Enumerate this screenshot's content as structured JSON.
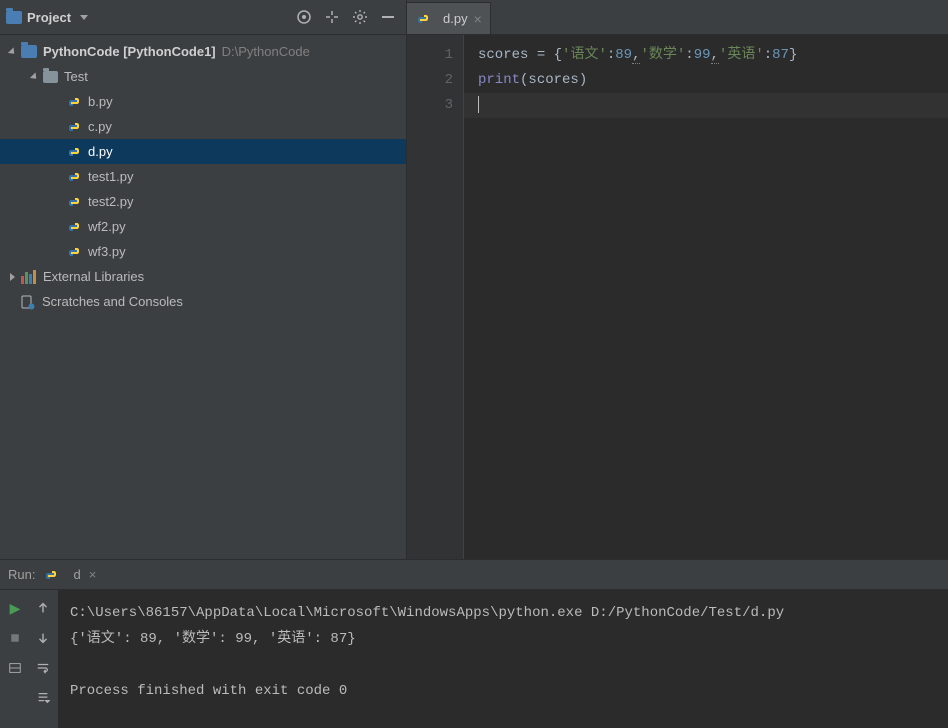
{
  "projectPanel": {
    "title": "Project",
    "rootName": "PythonCode",
    "rootExtra": "[PythonCode1]",
    "rootPath": "D:\\PythonCode",
    "testFolder": "Test",
    "files": [
      "b.py",
      "c.py",
      "d.py",
      "test1.py",
      "test2.py",
      "wf2.py",
      "wf3.py"
    ],
    "selectedFile": "d.py",
    "externalLibraries": "External Libraries",
    "scratches": "Scratches and Consoles"
  },
  "editor": {
    "tabName": "d.py",
    "lineNumbers": [
      "1",
      "2",
      "3"
    ],
    "code": {
      "l1": {
        "var": "scores",
        "eq": " = ",
        "open": "{",
        "k1": "'语文'",
        "c1": ":",
        "v1": "89",
        "s1": ",",
        "k2": "'数学'",
        "c2": ":",
        "v2": "99",
        "s2": ",",
        "k3": "'英语'",
        "c3": ":",
        "v3": "87",
        "close": "}"
      },
      "l2": {
        "fn": "print",
        "open": "(",
        "arg": "scores",
        "close": ")"
      }
    }
  },
  "run": {
    "label": "Run:",
    "configName": "d",
    "output": {
      "cmd": "C:\\Users\\86157\\AppData\\Local\\Microsoft\\WindowsApps\\python.exe D:/PythonCode/Test/d.py",
      "result": "{'语文': 89, '数学': 99, '英语': 87}",
      "exit": "Process finished with exit code 0"
    }
  }
}
